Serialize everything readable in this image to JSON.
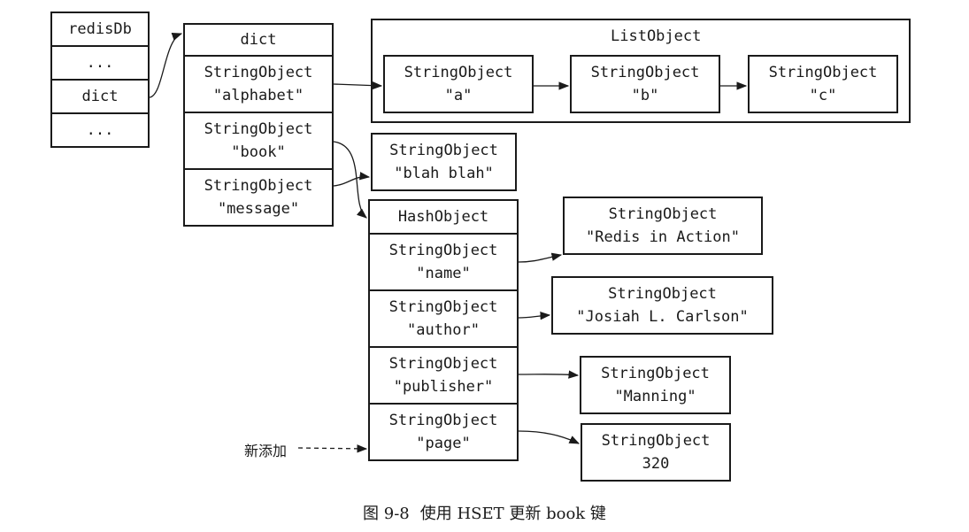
{
  "redisdb": {
    "header": "redisDb",
    "rows": [
      "...",
      "dict",
      "..."
    ]
  },
  "dict": {
    "header": "dict",
    "keys": [
      {
        "type": "StringObject",
        "value": "\"alphabet\""
      },
      {
        "type": "StringObject",
        "value": "\"book\""
      },
      {
        "type": "StringObject",
        "value": "\"message\""
      }
    ]
  },
  "list_object": {
    "label": "ListObject",
    "items": [
      {
        "type": "StringObject",
        "value": "\"a\""
      },
      {
        "type": "StringObject",
        "value": "\"b\""
      },
      {
        "type": "StringObject",
        "value": "\"c\""
      }
    ]
  },
  "message_value": {
    "type": "StringObject",
    "value": "\"blah blah\""
  },
  "hash_object": {
    "header": "HashObject",
    "fields": [
      {
        "type": "StringObject",
        "value": "\"name\""
      },
      {
        "type": "StringObject",
        "value": "\"author\""
      },
      {
        "type": "StringObject",
        "value": "\"publisher\""
      },
      {
        "type": "StringObject",
        "value": "\"page\""
      }
    ],
    "values": [
      {
        "type": "StringObject",
        "value": "\"Redis in Action\""
      },
      {
        "type": "StringObject",
        "value": "\"Josiah L. Carlson\""
      },
      {
        "type": "StringObject",
        "value": "\"Manning\""
      },
      {
        "type": "StringObject",
        "value": "320"
      }
    ]
  },
  "annotation": "新添加",
  "caption": {
    "figure": "图 9-8",
    "text": "使用 HSET 更新 book 键"
  }
}
